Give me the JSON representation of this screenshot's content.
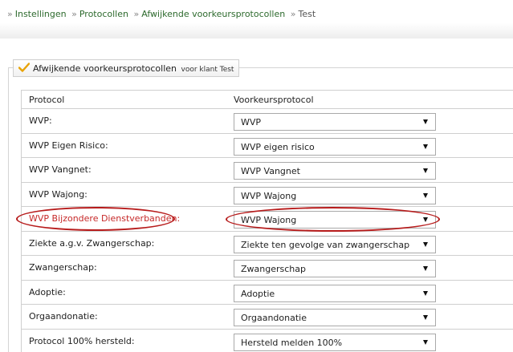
{
  "breadcrumb": {
    "prefix": "»",
    "items": [
      "Instellingen",
      "Protocollen",
      "Afwijkende voorkeursprotocollen",
      "Test"
    ]
  },
  "panel": {
    "title": "Afwijkende voorkeursprotocollen",
    "suffix": "voor klant Test"
  },
  "table": {
    "col_protocol": "Protocol",
    "col_voorkeur": "Voorkeursprotocol",
    "rows": [
      {
        "label": "WVP:",
        "value": "WVP"
      },
      {
        "label": "WVP Eigen Risico:",
        "value": "WVP eigen risico"
      },
      {
        "label": "WVP Vangnet:",
        "value": "WVP Vangnet"
      },
      {
        "label": "WVP Wajong:",
        "value": "WVP Wajong"
      },
      {
        "label": "WVP Bijzondere Dienstverbanden:",
        "value": "WVP Wajong"
      },
      {
        "label": "Ziekte a.g.v. Zwangerschap:",
        "value": "Ziekte ten gevolge van zwangerschap"
      },
      {
        "label": "Zwangerschap:",
        "value": "Zwangerschap"
      },
      {
        "label": "Adoptie:",
        "value": "Adoptie"
      },
      {
        "label": "Orgaandonatie:",
        "value": "Orgaandonatie"
      },
      {
        "label": "Protocol 100% hersteld:",
        "value": "Hersteld melden 100%"
      }
    ]
  },
  "colors": {
    "link": "#2d6a2d",
    "highlight": "#c62828",
    "check": "#e8a200"
  },
  "icons": {
    "panel": "checkmark-icon",
    "select": "dropdown-arrow-icon"
  }
}
